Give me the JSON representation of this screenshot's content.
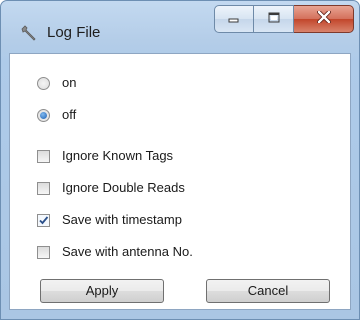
{
  "window": {
    "title": "Log File",
    "icon": "wrench-icon"
  },
  "caption_buttons": {
    "minimize": "minimize-icon",
    "maximize": "maximize-icon",
    "close": "close-icon"
  },
  "radios": [
    {
      "label": "on",
      "checked": false
    },
    {
      "label": "off",
      "checked": true
    }
  ],
  "checkboxes": [
    {
      "label": "Ignore Known Tags",
      "checked": false
    },
    {
      "label": "Ignore Double Reads",
      "checked": false
    },
    {
      "label": "Save with timestamp",
      "checked": true
    },
    {
      "label": "Save with antenna No.",
      "checked": false
    }
  ],
  "buttons": {
    "apply": "Apply",
    "cancel": "Cancel"
  },
  "colors": {
    "frame": "#b4cde8",
    "close_button": "#c2462b",
    "radio_dot": "#1b5fb3"
  }
}
